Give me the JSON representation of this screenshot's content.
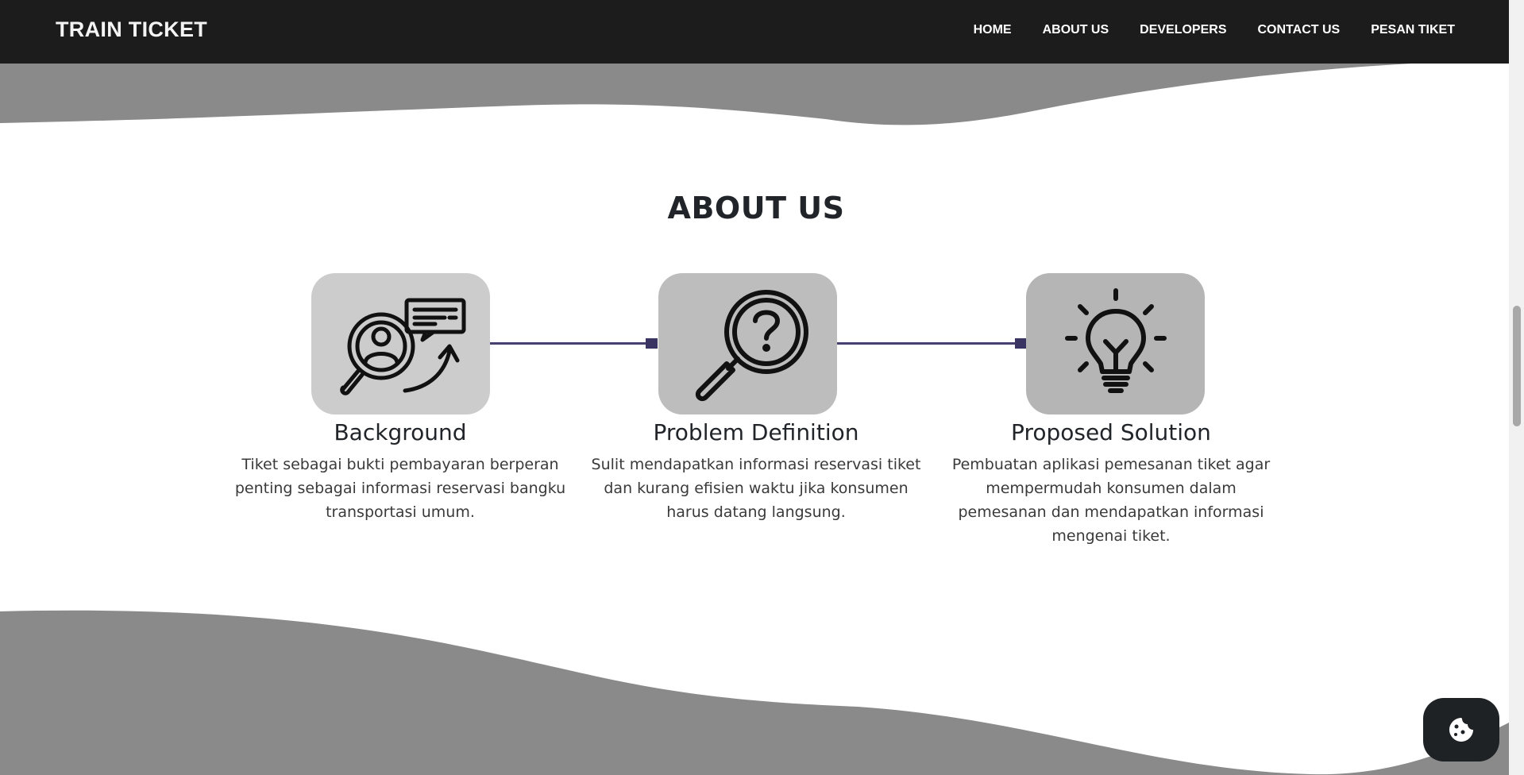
{
  "navbar": {
    "brand": "TRAIN TICKET",
    "links": [
      "HOME",
      "ABOUT US",
      "DEVELOPERS",
      "CONTACT US",
      "PESAN TIKET"
    ]
  },
  "about": {
    "title": "ABOUT US",
    "cards": [
      {
        "title": "Background",
        "text": "Tiket sebagai bukti pembayaran berperan penting sebagai informasi reservasi bangku transportasi umum.",
        "icon": "search-user-chart-icon"
      },
      {
        "title": "Problem Definition",
        "text": "Sulit mendapatkan informasi reservasi tiket dan kurang efisien waktu jika konsumen harus datang langsung.",
        "icon": "question-magnifier-icon"
      },
      {
        "title": "Proposed Solution",
        "text": "Pembuatan aplikasi pemesanan tiket agar mempermudah konsumen dalam pemesanan dan mendapatkan informasi mengenai tiket.",
        "icon": "lightbulb-icon"
      }
    ]
  },
  "floating_button": {
    "icon": "cookie-icon"
  },
  "colors": {
    "navbar": "#1c1c1c",
    "wave": "#8a8a8a",
    "icon_box": "#c4c4c4",
    "connector": "#47406e"
  }
}
